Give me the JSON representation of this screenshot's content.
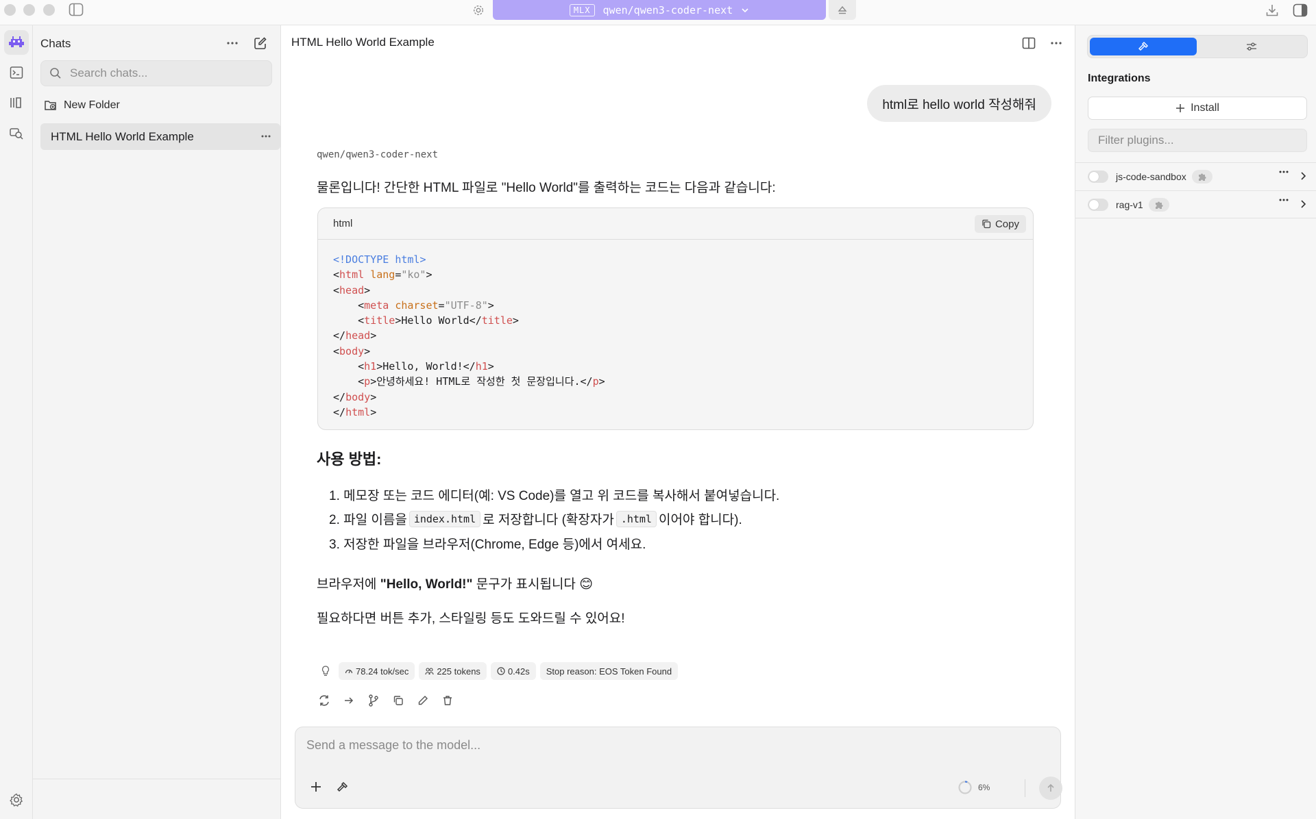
{
  "titlebar": {
    "model_badge": "MLX",
    "model_name": "qwen/qwen3-coder-next"
  },
  "sidebar": {
    "title": "Chats",
    "search_placeholder": "Search chats...",
    "new_folder_label": "New Folder",
    "chats": [
      {
        "title": "HTML Hello World Example"
      }
    ]
  },
  "conversation": {
    "title": "HTML Hello World Example",
    "user_message": "html로 hello world 작성해줘",
    "assistant_model": "qwen/qwen3-coder-next",
    "intro": "물론입니다! 간단한 HTML 파일로 \"Hello World\"를 출력하는 코드는 다음과 같습니다:",
    "code": {
      "language": "html",
      "copy_label": "Copy",
      "lines": {
        "l1_doctype": "<!DOCTYPE",
        "l1_html": "html",
        "l1_close": ">",
        "l2_open": "<",
        "l2_tag": "html",
        "l2_attr": "lang",
        "l2_eq": "=",
        "l2_val": "\"ko\"",
        "l2_close": ">",
        "l3_open": "<",
        "l3_tag": "head",
        "l3_close": ">",
        "l4_indent": "    ",
        "l4_open": "<",
        "l4_tag": "meta",
        "l4_attr": "charset",
        "l4_eq": "=",
        "l4_val": "\"UTF-8\"",
        "l4_close": ">",
        "l5_indent": "    ",
        "l5_open": "<",
        "l5_tag": "title",
        "l5_mid": ">Hello World</",
        "l5_tag2": "title",
        "l5_close": ">",
        "l6_open": "</",
        "l6_tag": "head",
        "l6_close": ">",
        "l7_open": "<",
        "l7_tag": "body",
        "l7_close": ">",
        "l8_indent": "    ",
        "l8_open": "<",
        "l8_tag": "h1",
        "l8_mid": ">Hello, World!</",
        "l8_tag2": "h1",
        "l8_close": ">",
        "l9_indent": "    ",
        "l9_open": "<",
        "l9_tag": "p",
        "l9_mid": ">안녕하세요! HTML로 작성한 첫 문장입니다.</",
        "l9_tag2": "p",
        "l9_close": ">",
        "l10_open": "</",
        "l10_tag": "body",
        "l10_close": ">",
        "l11_open": "</",
        "l11_tag": "html",
        "l11_close": ">"
      }
    },
    "usage_heading": "사용 방법:",
    "steps": {
      "s1": "1. 메모장 또는 코드 에디터(예: VS Code)를 열고 위 코드를 복사해서 붙여넣습니다.",
      "s2_pre": "2. 파일 이름을",
      "s2_code1": "index.html",
      "s2_mid": "로 저장합니다 (확장자가",
      "s2_code2": ".html",
      "s2_post": "이어야 합니다).",
      "s3": "3. 저장한 파일을 브라우저(Chrome, Edge 등)에서 여세요."
    },
    "result_pre": "브라우저에 ",
    "result_bold": "\"Hello, World!\"",
    "result_post": " 문구가 표시됩니다 😊",
    "closing": "필요하다면 버튼 추가, 스타일링 등도 도와드릴 수 있어요!",
    "stats": {
      "speed": "78.24 tok/sec",
      "tokens": "225 tokens",
      "time": "0.42s",
      "stop_reason": "Stop reason: EOS Token Found"
    }
  },
  "composer": {
    "placeholder": "Send a message to the model...",
    "context_usage": "6%",
    "context_fraction": 0.06
  },
  "right_panel": {
    "integrations_title": "Integrations",
    "install_label": "Install",
    "filter_placeholder": "Filter plugins...",
    "plugins": [
      {
        "name": "js-code-sandbox",
        "enabled": false
      },
      {
        "name": "rag-v1",
        "enabled": false
      }
    ]
  },
  "colors": {
    "accent_blue": "#1f6ef7",
    "model_bar": "#b2a5f8",
    "brand_purple": "#7b5cf0"
  }
}
